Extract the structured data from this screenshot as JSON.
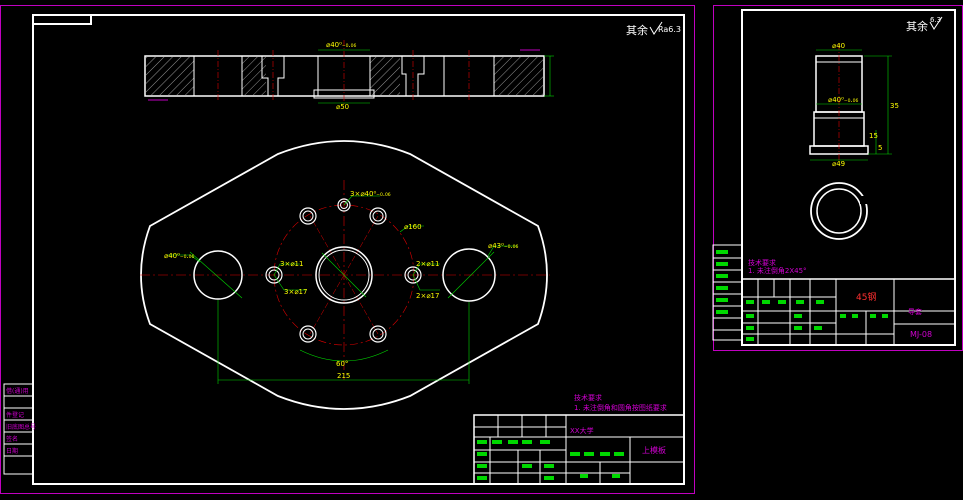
{
  "main_drawing": {
    "surface_finish_note": "其余",
    "surface_finish_value": "Ra6.3",
    "dims": {
      "top_bore": "⌀40⁰₋₀.₀₆",
      "top_bottom_bore": "⌀50",
      "hole_top": "3×⌀40⁰₋₀.₀₆",
      "left_bore": "⌀40⁰₋₀.₀₆",
      "right_bore": "⌀43⁰₋₀.₀₆",
      "pcd": "⌀160",
      "small_holes_left": "3×⌀11",
      "small_holes_left_cb": "3×⌀17",
      "small_holes_right": "2×⌀11",
      "small_holes_right_cb": "2×⌀17",
      "angle": "60°",
      "span": "215"
    },
    "tech_req_title": "技术要求",
    "tech_req_item": "1. 未注倒角和圆角按图纸要求",
    "title_block": {
      "name": "上模板",
      "company": "XX大学"
    },
    "left_strip": [
      "借(通)用",
      "件登记",
      "旧底图总号",
      "签名",
      "日期"
    ]
  },
  "side_drawing": {
    "surface_finish_note": "其余",
    "surface_finish_value": "6.3",
    "dims": {
      "top": "⌀40",
      "mid": "⌀40⁰₋₀.₀₆",
      "bottom": "⌀49",
      "height": "35",
      "h2": "15",
      "h3": "5"
    },
    "tech_req_title": "技术要求",
    "tech_req_item": "1. 未注倒角2X45°",
    "title_block": {
      "material": "45钢",
      "name": "导套",
      "code": "MJ-08"
    }
  }
}
